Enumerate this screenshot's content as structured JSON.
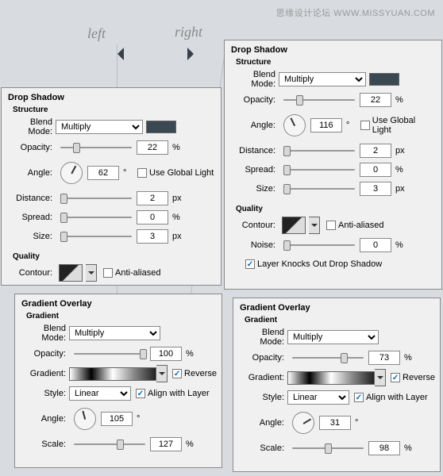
{
  "watermark": "思缘设计论坛  WWW.MISSYUAN.COM",
  "top_labels": {
    "left": "left",
    "right": "right"
  },
  "left_shadow": {
    "title": "Drop Shadow",
    "group": "Structure",
    "blend": {
      "label": "Blend Mode:",
      "value": "Multiply",
      "swatch": "#3a4852"
    },
    "opacity": {
      "label": "Opacity:",
      "value": "22",
      "unit": "%"
    },
    "angle": {
      "label": "Angle:",
      "value": "62",
      "unit": "°",
      "global": "Use Global Light",
      "global_on": false
    },
    "distance": {
      "label": "Distance:",
      "value": "2",
      "unit": "px"
    },
    "spread": {
      "label": "Spread:",
      "value": "0",
      "unit": "%"
    },
    "size": {
      "label": "Size:",
      "value": "3",
      "unit": "px"
    },
    "quality": "Quality",
    "contour": {
      "label": "Contour:",
      "anti": "Anti-aliased",
      "anti_on": false
    }
  },
  "right_shadow": {
    "title": "Drop Shadow",
    "group": "Structure",
    "blend": {
      "label": "Blend Mode:",
      "value": "Multiply",
      "swatch": "#3a4852"
    },
    "opacity": {
      "label": "Opacity:",
      "value": "22",
      "unit": "%"
    },
    "angle": {
      "label": "Angle:",
      "value": "116",
      "unit": "°",
      "global": "Use Global Light",
      "global_on": false
    },
    "distance": {
      "label": "Distance:",
      "value": "2",
      "unit": "px"
    },
    "spread": {
      "label": "Spread:",
      "value": "0",
      "unit": "%"
    },
    "size": {
      "label": "Size:",
      "value": "3",
      "unit": "px"
    },
    "quality": "Quality",
    "contour": {
      "label": "Contour:",
      "anti": "Anti-aliased",
      "anti_on": false
    },
    "noise": {
      "label": "Noise:",
      "value": "0",
      "unit": "%"
    },
    "knocks": {
      "label": "Layer Knocks Out Drop Shadow",
      "on": true
    }
  },
  "left_grad": {
    "title": "Gradient Overlay",
    "group": "Gradient",
    "blend": {
      "label": "Blend Mode:",
      "value": "Multiply"
    },
    "opacity": {
      "label": "Opacity:",
      "value": "100",
      "unit": "%"
    },
    "gradient": {
      "label": "Gradient:",
      "reverse": "Reverse",
      "reverse_on": true
    },
    "style": {
      "label": "Style:",
      "value": "Linear",
      "align": "Align with Layer",
      "align_on": true
    },
    "angle": {
      "label": "Angle:",
      "value": "105",
      "unit": "°"
    },
    "scale": {
      "label": "Scale:",
      "value": "127",
      "unit": "%"
    }
  },
  "right_grad": {
    "title": "Gradient Overlay",
    "group": "Gradient",
    "blend": {
      "label": "Blend Mode:",
      "value": "Multiply"
    },
    "opacity": {
      "label": "Opacity:",
      "value": "73",
      "unit": "%"
    },
    "gradient": {
      "label": "Gradient:",
      "reverse": "Reverse",
      "reverse_on": true
    },
    "style": {
      "label": "Style:",
      "value": "Linear",
      "align": "Align with Layer",
      "align_on": true
    },
    "angle": {
      "label": "Angle:",
      "value": "31",
      "unit": "°"
    },
    "scale": {
      "label": "Scale:",
      "value": "98",
      "unit": "%"
    }
  }
}
